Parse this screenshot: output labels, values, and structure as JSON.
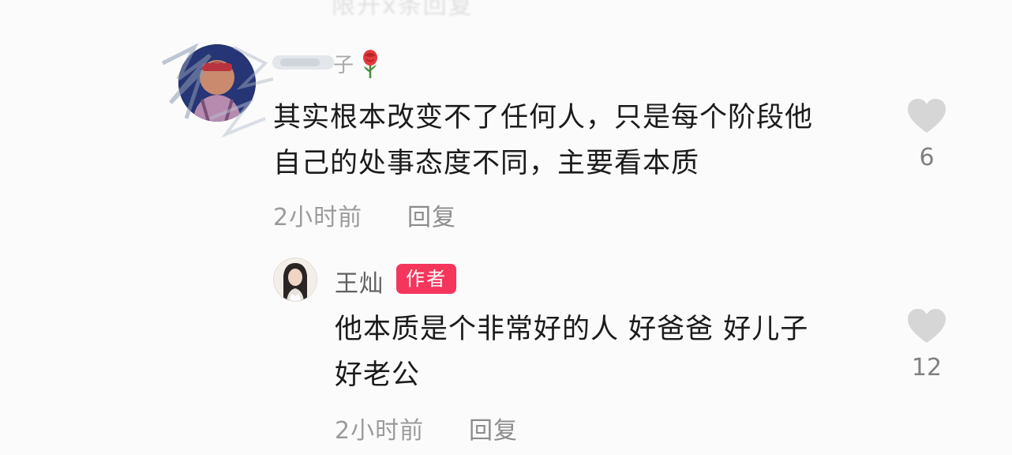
{
  "top_fragment": "限开x条回复",
  "comments": [
    {
      "username_suffix": "子",
      "emoji_icon": "rose-icon",
      "text_line1": "其实根本改变不了任何人，只是每个阶段他",
      "text_line2": "自己的处事态度不同，主要看本质",
      "time": "2小时前",
      "reply_label": "回复",
      "like_count": "6"
    }
  ],
  "reply": {
    "username": "王灿",
    "badge": "作者",
    "text_line1": "他本质是个非常好的人 好爸爸 好儿子",
    "text_line2": "好老公",
    "time": "2小时前",
    "reply_label": "回复",
    "like_count": "12"
  },
  "colors": {
    "text": "#1b1b1b",
    "meta": "#9b9b9b",
    "heart": "#d6d6d6",
    "badge": "#f5365c"
  }
}
